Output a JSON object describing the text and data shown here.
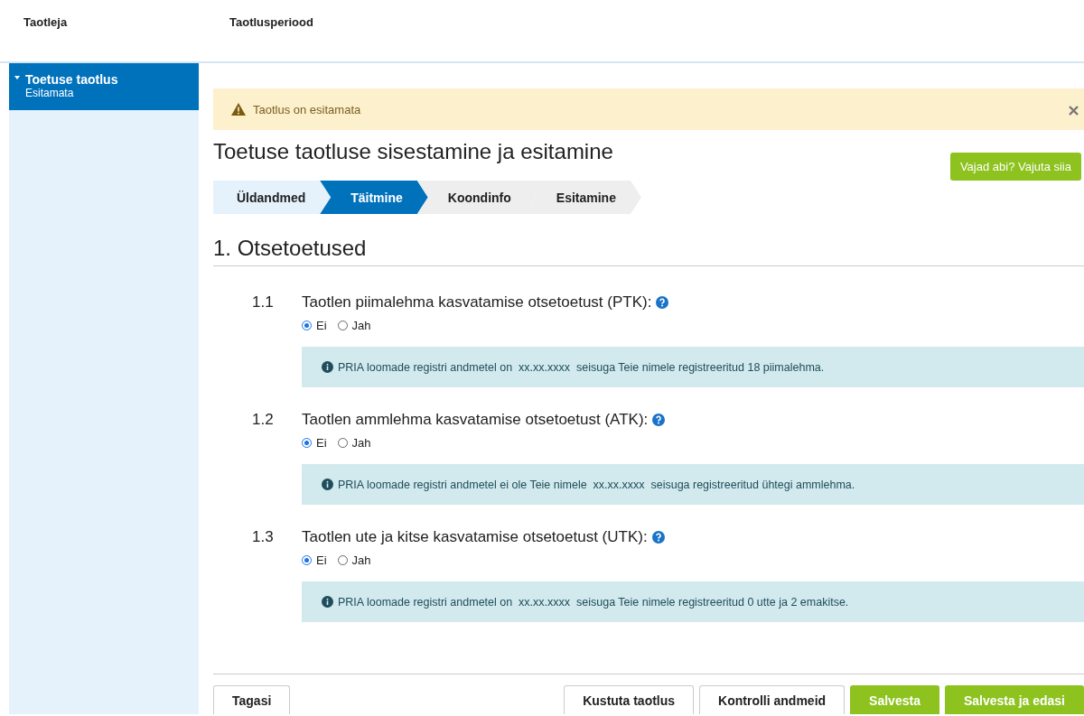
{
  "header": {
    "applicant_label": "Taotleja",
    "period_label": "Taotlusperiood"
  },
  "sidebar": {
    "items": [
      {
        "title": "Toetuse taotlus",
        "subtitle": "Esitamata",
        "selected": true,
        "expanded": true
      }
    ]
  },
  "alert": {
    "text": "Taotlus on esitamata"
  },
  "page_title": "Toetuse taotluse sisestamine ja esitamine",
  "help_button": "Vajad abi? Vajuta siia",
  "steps": [
    {
      "label": "Üldandmed",
      "selected": false,
      "completed": true
    },
    {
      "label": "Täitmine",
      "selected": true,
      "completed": false
    },
    {
      "label": "Koondinfo",
      "selected": false,
      "completed": false
    },
    {
      "label": "Esitamine",
      "selected": false,
      "completed": false
    }
  ],
  "section_title": "1. Otsetoetused",
  "questions": [
    {
      "number": "1.1",
      "text": "Taotlen piimalehma kasvatamise otsetoetust (PTK):",
      "options": [
        {
          "label": "Ei",
          "selected": true
        },
        {
          "label": "Jah",
          "selected": false
        }
      ],
      "info": "PRIA loomade registri andmetel on  xx.xx.xxxx  seisuga Teie nimele registreeritud 18 piimalehma."
    },
    {
      "number": "1.2",
      "text": "Taotlen ammlehma kasvatamise otsetoetust (ATK):",
      "options": [
        {
          "label": "Ei",
          "selected": true
        },
        {
          "label": "Jah",
          "selected": false
        }
      ],
      "info": "PRIA loomade registri andmetel ei ole Teie nimele  xx.xx.xxxx  seisuga registreeritud ühtegi ammlehma."
    },
    {
      "number": "1.3",
      "text": "Taotlen ute ja kitse kasvatamise otsetoetust (UTK):",
      "options": [
        {
          "label": "Ei",
          "selected": true
        },
        {
          "label": "Jah",
          "selected": false
        }
      ],
      "info": "PRIA loomade registri andmetel on  xx.xx.xxxx  seisuga Teie nimele registreeritud 0 utte ja 2 emakitse."
    }
  ],
  "footer": {
    "back_button": "Tagasi",
    "buttons": [
      {
        "label": "Kustuta taotlus",
        "kind": "default"
      },
      {
        "label": "Kontrolli andmeid",
        "kind": "default"
      },
      {
        "label": "Salvesta",
        "kind": "primary"
      },
      {
        "label": "Salvesta ja edasi",
        "kind": "primary"
      }
    ]
  }
}
